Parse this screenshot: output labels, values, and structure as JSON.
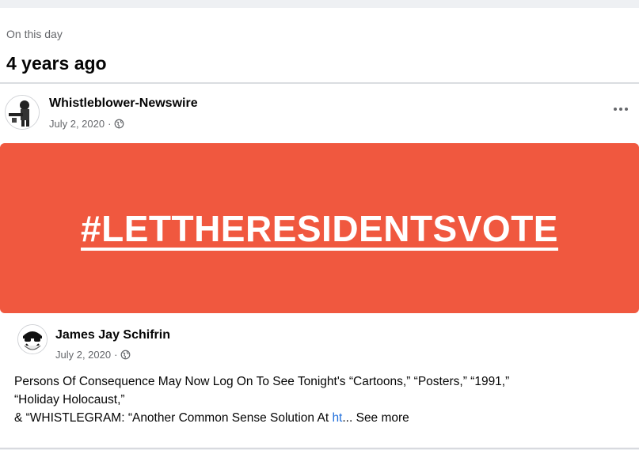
{
  "memory": {
    "label": "On this day",
    "title": "4 years ago"
  },
  "post": {
    "author": "Whistleblower-Newswire",
    "date": "July 2, 2020",
    "more_icon": "ellipsis-icon",
    "banner": {
      "hashtag": "#LETTHERESIDENTSVOTE",
      "background_color": "#f0583f"
    },
    "shared": {
      "author": "James Jay Schifrin",
      "date": "July 2, 2020",
      "text_line1": "Persons Of Consequence May Now Log On To See Tonight's “Cartoons,” “Posters,” “1991,”",
      "text_line2": "“Holiday Holocaust,”",
      "text_line3_prefix": "& “WHISTLEGRAM:  “Another Common Sense Solution At ",
      "link_fragment": "ht",
      "ellipsis": "...",
      "see_more": " See more"
    }
  },
  "icons": {
    "privacy": "globe-icon"
  }
}
